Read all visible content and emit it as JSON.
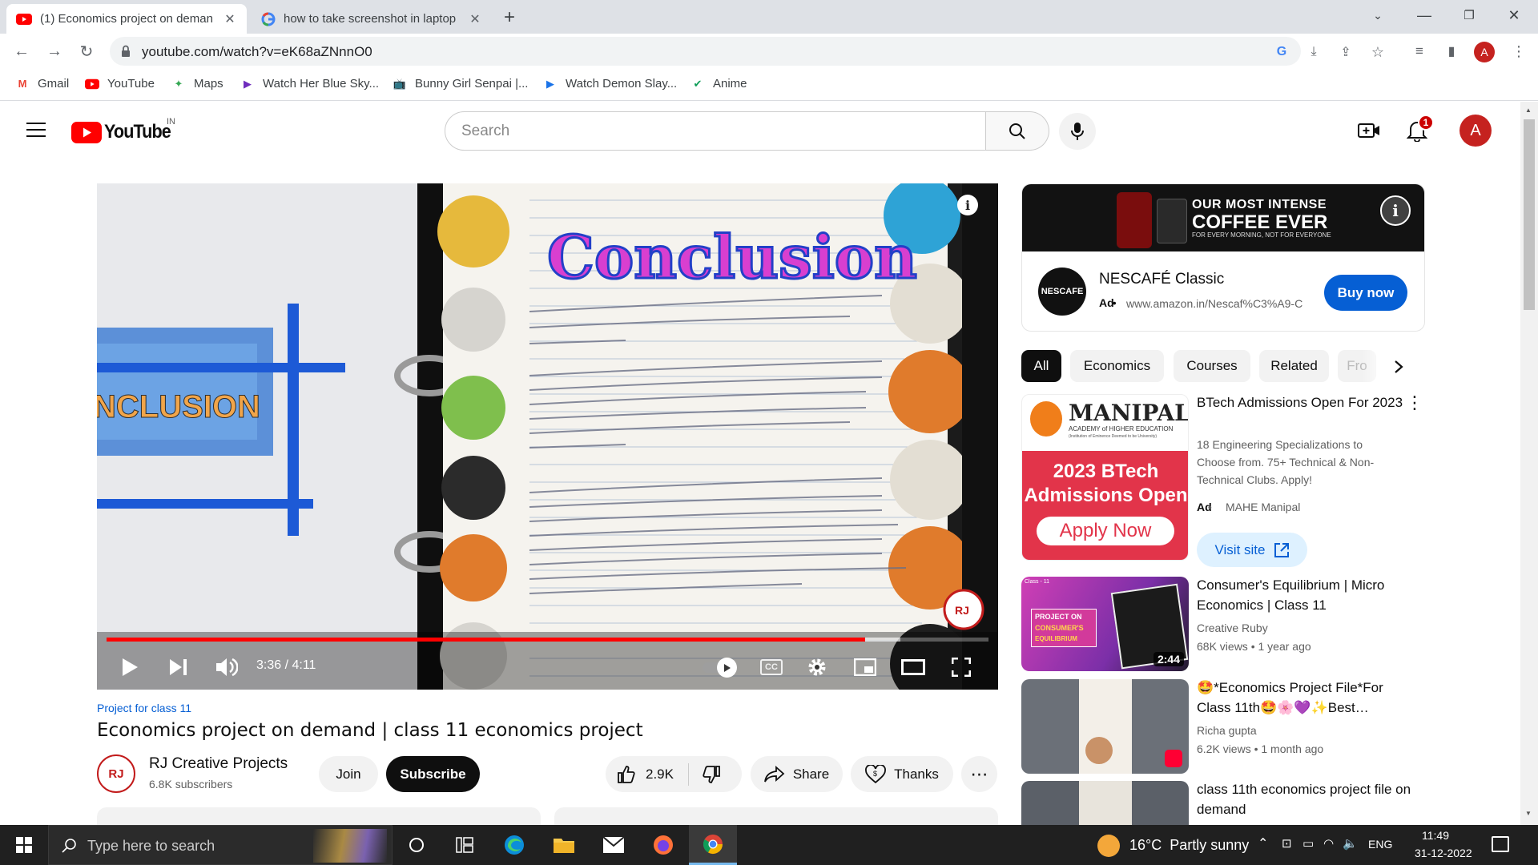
{
  "browser": {
    "tabs": [
      {
        "title": "(1) Economics project on deman",
        "active": true
      },
      {
        "title": "how to take screenshot in laptop",
        "active": false
      }
    ],
    "url": "youtube.com/watch?v=eK68aZNnnO0",
    "profile_initial": "A",
    "bookmarks": [
      {
        "label": "Gmail",
        "icon": "gmail-icon"
      },
      {
        "label": "YouTube",
        "icon": "youtube-icon"
      },
      {
        "label": "Maps",
        "icon": "maps-icon"
      },
      {
        "label": "Watch Her Blue Sky...",
        "icon": "play-icon"
      },
      {
        "label": "Bunny Girl Senpai |...",
        "icon": "tv-icon"
      },
      {
        "label": "Watch Demon Slay...",
        "icon": "play-icon"
      },
      {
        "label": "Anime",
        "icon": "anime-icon"
      }
    ]
  },
  "youtube": {
    "logo_text": "YouTube",
    "region": "IN",
    "search_placeholder": "Search",
    "notification_count": "1",
    "avatar_initial": "A"
  },
  "player": {
    "time": "3:36 / 4:11",
    "progress": 0.86,
    "buffered": 0.9
  },
  "video": {
    "hashtag": "Project for class 11",
    "title": "Economics project on demand | class 11 economics project",
    "channel": "RJ Creative Projects",
    "subscribers": "6.8K subscribers",
    "join_label": "Join",
    "subscribe_label": "Subscribe",
    "likes": "2.9K",
    "share_label": "Share",
    "thanks_label": "Thanks"
  },
  "ad": {
    "banner_line1": "OUR MOST INTENSE",
    "banner_line2": "COFFEE EVER",
    "banner_line3": "FOR EVERY MORNING, NOT FOR EVERYONE",
    "brand": "NESCAFÉ Classic",
    "logo_text": "NESCAFE",
    "ad_label": "Ad",
    "url": "www.amazon.in/Nescaf%C3%A9-C",
    "cta": "Buy now"
  },
  "chips": [
    "All",
    "Economics",
    "Courses",
    "Related",
    "Fro"
  ],
  "recommendations": {
    "ad_item": {
      "brand": "MANIPAL",
      "brand_sub": "ACADEMY of HIGHER EDUCATION",
      "brand_sub2": "(Institution of Eminence Deemed to be University)",
      "banner_line1": "2023 BTech",
      "banner_line2": "Admissions Open",
      "banner_cta": "Apply Now",
      "title": "BTech Admissions Open For 2023",
      "description": "18 Engineering Specializations to Choose from. 75+ Technical & Non-Technical Clubs. Apply!",
      "ad_label": "Ad",
      "advertiser": "MAHE Manipal",
      "cta": "Visit site"
    },
    "videos": [
      {
        "title": "Consumer's Equilibrium | Micro Economics | Class 11",
        "channel": "Creative Ruby",
        "meta": "68K views • 1 year ago",
        "duration": "2:44",
        "thumb_text1": "PROJECT ON",
        "thumb_text2": "CONSUMER'S",
        "thumb_text3": "EQUILIBRIUM",
        "thumb_label": "Class - 11"
      },
      {
        "title": "🤩*Economics Project File*For Class 11th🤩🌸💜✨Best…",
        "channel": "Richa gupta",
        "meta": "6.2K views • 1 month ago",
        "duration": ""
      },
      {
        "title": "class 11th economics project file on demand",
        "channel": "",
        "meta": "",
        "duration": ""
      }
    ]
  },
  "taskbar": {
    "search_placeholder": "Type here to search",
    "weather": "16°C  Partly sunny",
    "language": "ENG",
    "time": "11:49",
    "date": "31-12-2022"
  }
}
